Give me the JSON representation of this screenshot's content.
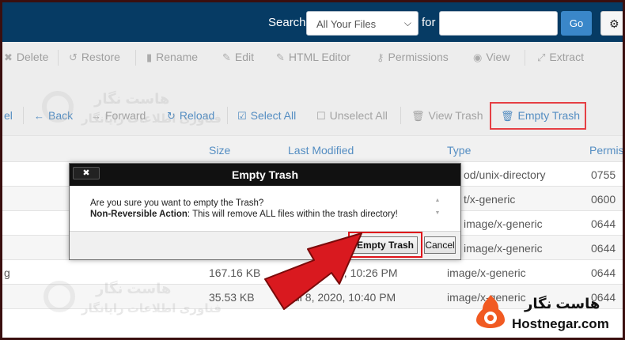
{
  "topbar": {
    "search_label": "Search",
    "search_scope": "All Your Files",
    "for_label": "for",
    "search_value": "",
    "go_label": "Go",
    "settings_label": "▾"
  },
  "toolbar1": {
    "delete": "Delete",
    "restore": "Restore",
    "rename": "Rename",
    "edit": "Edit",
    "html_editor": "HTML Editor",
    "permissions": "Permissions",
    "view": "View",
    "extract": "Extract"
  },
  "toolbar2": {
    "partial": "el",
    "back": "Back",
    "forward": "Forward",
    "reload": "Reload",
    "select_all": "Select All",
    "unselect_all": "Unselect All",
    "view_trash": "View Trash",
    "empty_trash": "Empty Trash"
  },
  "table": {
    "headers": {
      "size": "Size",
      "last_modified": "Last Modified",
      "type": "Type",
      "perms": "Permis"
    },
    "rows": [
      {
        "name": "",
        "size": "",
        "modified": "",
        "type": "od/unix-directory",
        "perms": "0755"
      },
      {
        "name": "",
        "size": "",
        "modified": "",
        "type": "t/x-generic",
        "perms": "0600"
      },
      {
        "name": "",
        "size": "",
        "modified": "",
        "type": "image/x-generic",
        "perms": "0644"
      },
      {
        "name": "",
        "size": "",
        "modified": "",
        "type": "image/x-generic",
        "perms": "0644"
      },
      {
        "name": "g",
        "size": "167.16 KB",
        "modified": "0, 10:26 PM",
        "type": "image/x-generic",
        "perms": "0644"
      },
      {
        "name": "",
        "size": "35.53 KB",
        "modified": "Jul 8, 2020, 10:40 PM",
        "type": "image/x-generic",
        "perms": "0644"
      }
    ]
  },
  "dialog": {
    "title": "Empty Trash",
    "close_label": "✖",
    "line1": "Are you sure you want to empty the Trash?",
    "line2_bold": "Non-Reversible Action",
    "line2_rest": ": This will remove ALL files within the trash directory!",
    "confirm_label": "Empty Trash",
    "cancel_label": "Cancel"
  },
  "watermark": {
    "fa1": "هاست نگار",
    "fa2": "فناوری اطلاعات رایانگار"
  },
  "brand": {
    "fa_name": "هاست نگار",
    "en_name": "Hostnegar.com"
  },
  "colors": {
    "topbar": "#063b64",
    "link": "#2f75b5",
    "highlight": "#e0151b",
    "go_button": "#3a87c9"
  }
}
